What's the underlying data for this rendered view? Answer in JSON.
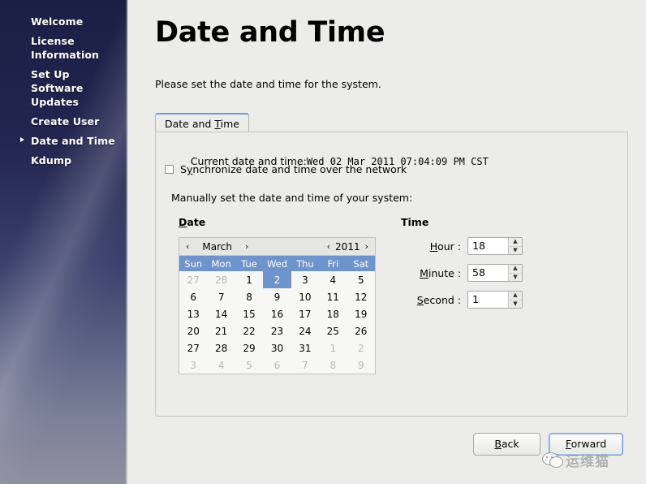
{
  "sidebar": {
    "items": [
      {
        "label": "Welcome",
        "active": false
      },
      {
        "label": "License Information",
        "active": false
      },
      {
        "label": "Set Up Software Updates",
        "active": false
      },
      {
        "label": "Create User",
        "active": false
      },
      {
        "label": "Date and Time",
        "active": true
      },
      {
        "label": "Kdump",
        "active": false
      }
    ],
    "active_marker_icon": "right-arrow-icon"
  },
  "page": {
    "title": "Date and Time",
    "subtitle": "Please set the date and time for the system."
  },
  "tabs": [
    {
      "label_before": "Date and ",
      "mnemonic": "T",
      "label_after": "ime",
      "selected": true
    }
  ],
  "panel": {
    "current_datetime_label": "Current date and time:",
    "current_datetime_value": "Wed 02 Mar 2011 07:04:09 PM CST",
    "sync_checkbox": {
      "label_before": "S",
      "mnemonic": "y",
      "label_after": "nchronize date and time over the network",
      "checked": false
    },
    "manual_label": "Manually set the date and time of your system:"
  },
  "date_group": {
    "title_mnemonic": "D",
    "title_rest": "ate",
    "calendar": {
      "prev_month_icon": "chevron-left-icon",
      "next_month_icon": "chevron-right-icon",
      "prev_year_icon": "chevron-left-icon",
      "next_year_icon": "chevron-right-icon",
      "month": "March",
      "year": "2011",
      "weekdays": [
        "Sun",
        "Mon",
        "Tue",
        "Wed",
        "Thu",
        "Fri",
        "Sat"
      ],
      "selected_day": 2,
      "weeks": [
        [
          {
            "d": "27",
            "dim": true
          },
          {
            "d": "28",
            "dim": true
          },
          {
            "d": "1",
            "dim": false
          },
          {
            "d": "2",
            "dim": false,
            "selected": true
          },
          {
            "d": "3",
            "dim": false
          },
          {
            "d": "4",
            "dim": false
          },
          {
            "d": "5",
            "dim": false
          }
        ],
        [
          {
            "d": "6",
            "dim": false
          },
          {
            "d": "7",
            "dim": false
          },
          {
            "d": "8",
            "dim": false
          },
          {
            "d": "9",
            "dim": false
          },
          {
            "d": "10",
            "dim": false
          },
          {
            "d": "11",
            "dim": false
          },
          {
            "d": "12",
            "dim": false
          }
        ],
        [
          {
            "d": "13",
            "dim": false
          },
          {
            "d": "14",
            "dim": false
          },
          {
            "d": "15",
            "dim": false
          },
          {
            "d": "16",
            "dim": false
          },
          {
            "d": "17",
            "dim": false
          },
          {
            "d": "18",
            "dim": false
          },
          {
            "d": "19",
            "dim": false
          }
        ],
        [
          {
            "d": "20",
            "dim": false
          },
          {
            "d": "21",
            "dim": false
          },
          {
            "d": "22",
            "dim": false
          },
          {
            "d": "23",
            "dim": false
          },
          {
            "d": "24",
            "dim": false
          },
          {
            "d": "25",
            "dim": false
          },
          {
            "d": "26",
            "dim": false
          }
        ],
        [
          {
            "d": "27",
            "dim": false
          },
          {
            "d": "28",
            "dim": false
          },
          {
            "d": "29",
            "dim": false
          },
          {
            "d": "30",
            "dim": false
          },
          {
            "d": "31",
            "dim": false
          },
          {
            "d": "1",
            "dim": true
          },
          {
            "d": "2",
            "dim": true
          }
        ],
        [
          {
            "d": "3",
            "dim": true
          },
          {
            "d": "4",
            "dim": true
          },
          {
            "d": "5",
            "dim": true
          },
          {
            "d": "6",
            "dim": true
          },
          {
            "d": "7",
            "dim": true
          },
          {
            "d": "8",
            "dim": true
          },
          {
            "d": "9",
            "dim": true
          }
        ]
      ]
    }
  },
  "time_group": {
    "title": "Time",
    "fields": [
      {
        "mnemonic": "H",
        "label_rest": "our :",
        "value": "18"
      },
      {
        "mnemonic": "M",
        "label_rest": "inute :",
        "value": "58"
      },
      {
        "mnemonic": "S",
        "label_rest": "econd :",
        "value": "1"
      }
    ],
    "spinner_up_icon": "chevron-up-icon",
    "spinner_down_icon": "chevron-down-icon"
  },
  "footer": {
    "back": {
      "mnemonic": "B",
      "label_rest": "ack"
    },
    "forward": {
      "mnemonic": "F",
      "label_rest": "orward",
      "focused": true
    }
  },
  "watermark": {
    "text": "运维猫",
    "icon": "wechat-icon"
  },
  "colors": {
    "accent_blue": "#6f93cb",
    "tab_accent": "#6f9bd4",
    "panel_bg": "#ececeb",
    "sidebar_top": "#1b1f45",
    "sidebar_bottom": "#8d909f",
    "focus_border": "#7a9ed4"
  }
}
